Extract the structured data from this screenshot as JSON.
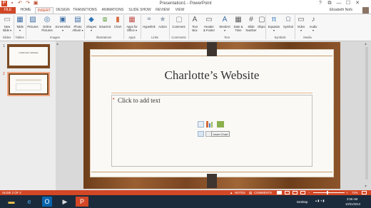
{
  "window": {
    "title": "Presentation1 - PowerPoint"
  },
  "qat": {
    "icons": [
      "powerpoint-icon",
      "save-icon",
      "undo-icon",
      "redo-icon",
      "present-icon"
    ]
  },
  "window_controls": {
    "help": "?",
    "restore": "⧉",
    "minimize": "—",
    "maximize": "☐",
    "close": "✕"
  },
  "tabs": [
    {
      "label": "FILE"
    },
    {
      "label": "HOME"
    },
    {
      "label": "INSERT"
    },
    {
      "label": "DESIGN"
    },
    {
      "label": "TRANSITIONS"
    },
    {
      "label": "ANIMATIONS"
    },
    {
      "label": "SLIDE SHOW"
    },
    {
      "label": "REVIEW"
    },
    {
      "label": "VIEW"
    }
  ],
  "user": {
    "name": "Elizabeth Nofs"
  },
  "ribbon": {
    "buttons": [
      {
        "label1": "New",
        "label2": "Slide ▾",
        "icon": "new-slide-icon",
        "glyph": "▭"
      },
      {
        "label1": "Table",
        "label2": "▾",
        "icon": "table-icon",
        "glyph": "▦"
      },
      {
        "label1": "Pictures",
        "label2": "",
        "icon": "pictures-icon",
        "glyph": "▨"
      },
      {
        "label1": "Online",
        "label2": "Pictures",
        "icon": "online-pictures-icon",
        "glyph": "◎"
      },
      {
        "label1": "Screenshot",
        "label2": "▾",
        "icon": "screenshot-icon",
        "glyph": "▣"
      },
      {
        "label1": "Photo",
        "label2": "Album ▾",
        "icon": "photo-album-icon",
        "glyph": "▤"
      },
      {
        "label1": "Shapes",
        "label2": "▾",
        "icon": "shapes-icon",
        "glyph": "◆"
      },
      {
        "label1": "SmartArt",
        "label2": "",
        "icon": "smartart-icon",
        "glyph": "⧈"
      },
      {
        "label1": "Chart",
        "label2": "",
        "icon": "chart-icon",
        "glyph": "▮"
      },
      {
        "label1": "Apps for",
        "label2": "Office ▾",
        "icon": "apps-icon",
        "glyph": "▦"
      },
      {
        "label1": "Hyperlink",
        "label2": "",
        "icon": "hyperlink-icon",
        "glyph": "⚭"
      },
      {
        "label1": "Action",
        "label2": "",
        "icon": "action-icon",
        "glyph": "★"
      },
      {
        "label1": "Comment",
        "label2": "",
        "icon": "comment-icon",
        "glyph": "▢"
      },
      {
        "label1": "Text",
        "label2": "Box",
        "icon": "text-box-icon",
        "glyph": "A"
      },
      {
        "label1": "Header",
        "label2": "& Footer",
        "icon": "header-footer-icon",
        "glyph": "▭"
      },
      {
        "label1": "WordArt",
        "label2": "▾",
        "icon": "wordart-icon",
        "glyph": "A"
      },
      {
        "label1": "Date &",
        "label2": "Time",
        "icon": "date-time-icon",
        "glyph": "▦"
      },
      {
        "label1": "Slide",
        "label2": "Number",
        "icon": "slide-number-icon",
        "glyph": "#"
      },
      {
        "label1": "Object",
        "label2": "",
        "icon": "object-icon",
        "glyph": "▢"
      },
      {
        "label1": "Equation",
        "label2": "▾",
        "icon": "equation-icon",
        "glyph": "π"
      },
      {
        "label1": "Symbol",
        "label2": "",
        "icon": "symbol-icon",
        "glyph": "Ω"
      },
      {
        "label1": "Video",
        "label2": "▾",
        "icon": "video-icon",
        "glyph": "▭"
      },
      {
        "label1": "Audio",
        "label2": "▾",
        "icon": "audio-icon",
        "glyph": "♪"
      }
    ],
    "groups": [
      "Slides",
      "Tables",
      "Images",
      "Illustrations",
      "Apps",
      "Links",
      "Comments",
      "Text",
      "Symbols",
      "Media"
    ]
  },
  "thumbnails": [
    {
      "number": "1",
      "title": "Charlotte's Website"
    },
    {
      "number": "2",
      "title": ""
    }
  ],
  "slide": {
    "title": "Charlotte’s Website",
    "content_placeholder": "Click to add text",
    "bullet": "•",
    "tooltip": "Insert Chart",
    "insert_icons": [
      "insert-table-icon",
      "insert-chart-icon",
      "insert-smartart-icon",
      "insert-pictures-icon",
      "insert-online-pictures-icon",
      "insert-video-icon"
    ]
  },
  "status": {
    "slide_counter": "SLIDE 2 OF 2",
    "notes": "NOTES",
    "comments": "COMMENTS",
    "zoom": "74%",
    "notes_icon": "▲",
    "comments_icon": "▤"
  },
  "taskbar": {
    "apps": [
      {
        "icon": "file-explorer-icon",
        "glyph": "▬"
      },
      {
        "icon": "internet-explorer-icon",
        "glyph": "e"
      },
      {
        "icon": "outlook-icon",
        "glyph": "O"
      },
      {
        "icon": "media-icon",
        "glyph": "▶"
      },
      {
        "icon": "powerpoint-taskbar-icon",
        "glyph": "P"
      }
    ],
    "desktop_label": "Desktop",
    "time": "3:56 AM",
    "date": "10/31/2013"
  },
  "colors": {
    "accent": "#d24726",
    "taskbar": "#1c2b3c",
    "wood": "#7a4522"
  }
}
